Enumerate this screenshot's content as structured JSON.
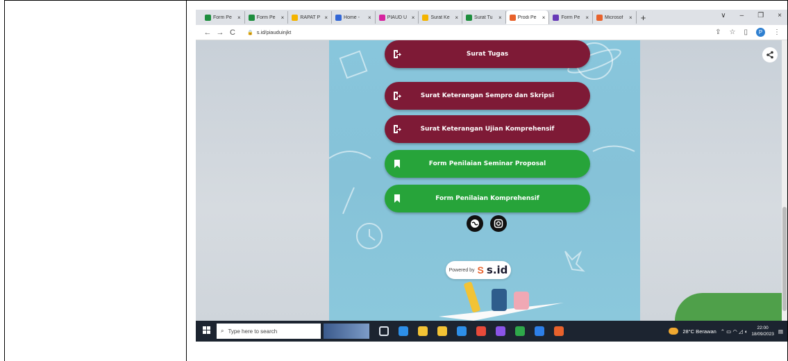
{
  "browser": {
    "tabs": [
      {
        "label": "Form Pe",
        "color": "#1e8e3e",
        "active": false
      },
      {
        "label": "Form Pe",
        "color": "#1e8e3e",
        "active": false
      },
      {
        "label": "RAPAT P",
        "color": "#f4b400",
        "active": false
      },
      {
        "label": "Home -",
        "color": "#3367d6",
        "active": false
      },
      {
        "label": "PIAUD U",
        "color": "#d6249f",
        "active": false
      },
      {
        "label": "Surat Ke",
        "color": "#f4b400",
        "active": false
      },
      {
        "label": "Surat Tu",
        "color": "#1e8e3e",
        "active": false
      },
      {
        "label": "Prodi Pe",
        "color": "#e8622c",
        "active": true
      },
      {
        "label": "Form Pe",
        "color": "#673ab7",
        "active": false
      },
      {
        "label": "Microsof",
        "color": "#e8622c",
        "active": false
      }
    ],
    "tab_close": "×",
    "new_tab": "+",
    "window_controls": [
      "∨",
      "–",
      "❐",
      "×"
    ],
    "nav": {
      "back": "←",
      "forward": "→",
      "reload": "C"
    },
    "url": "s.id/piauduinjkt",
    "profile_initial": "P"
  },
  "page": {
    "buttons": [
      {
        "label": "Surat Tugas",
        "style": "red",
        "icon": "login-icon"
      },
      {
        "label": "Surat Keterangan Sempro dan Skripsi",
        "style": "red",
        "icon": "login-icon"
      },
      {
        "label": "Surat Keterangan Ujian Komprehensif",
        "style": "red",
        "icon": "login-icon"
      },
      {
        "label": "Form Penilaian Seminar Proposal",
        "style": "green",
        "icon": "bookmark-icon"
      },
      {
        "label": "Form Penilaian Komprehensif",
        "style": "green",
        "icon": "bookmark-icon"
      }
    ],
    "powered_by": "Powered by",
    "brand": "s.id",
    "brand_mark": "S"
  },
  "taskbar": {
    "search_placeholder": "Type here to search",
    "weather": "28°C Berawan",
    "time": "22:00",
    "date": "18/09/2023",
    "app_colors": [
      "#dfe6ee",
      "#2d8fe8",
      "#f2c335",
      "#f2c335",
      "#2d8fe8",
      "#e84a3a",
      "#8a54e8",
      "#2ea84a",
      "#2d7fe8",
      "#e8622c"
    ]
  }
}
